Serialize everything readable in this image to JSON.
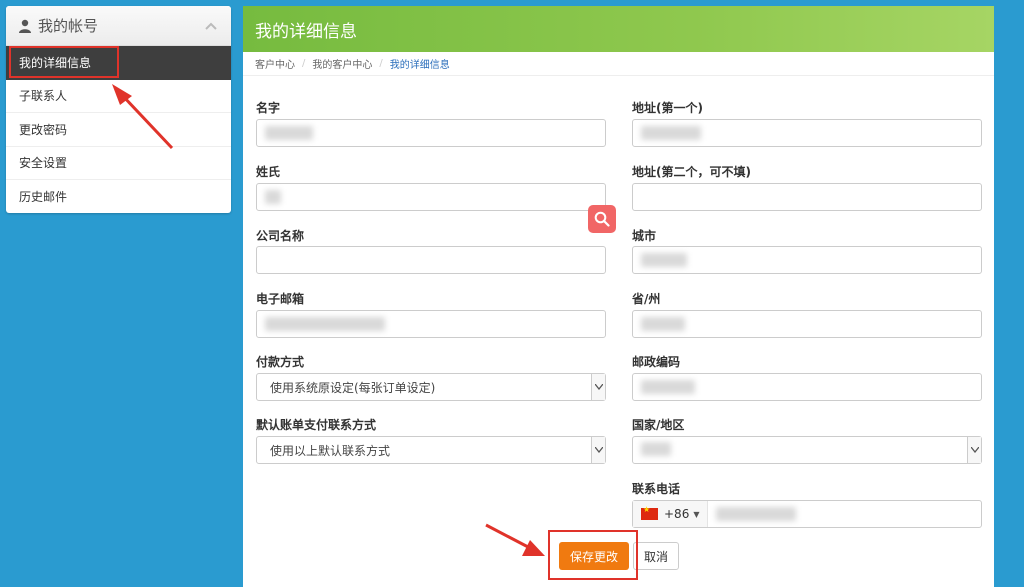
{
  "sidebar": {
    "title": "我的帐号",
    "items": [
      {
        "label": "我的详细信息"
      },
      {
        "label": "子联系人"
      },
      {
        "label": "更改密码"
      },
      {
        "label": "安全设置"
      },
      {
        "label": "历史邮件"
      }
    ]
  },
  "main": {
    "title": "我的详细信息",
    "breadcrumb": [
      "客户中心",
      "我的客户中心",
      "我的详细信息"
    ]
  },
  "form": {
    "first_name_label": "名字",
    "last_name_label": "姓氏",
    "company_label": "公司名称",
    "email_label": "电子邮箱",
    "payment_label": "付款方式",
    "payment_value": "使用系统原设定(每张订单设定)",
    "billing_contact_label": "默认账单支付联系方式",
    "billing_contact_value": "使用以上默认联系方式",
    "address1_label": "地址(第一个)",
    "address2_label": "地址(第二个，可不填)",
    "city_label": "城市",
    "state_label": "省/州",
    "postcode_label": "邮政编码",
    "country_label": "国家/地区",
    "phone_label": "联系电话",
    "phone_code": "+86"
  },
  "buttons": {
    "save": "保存更改",
    "cancel": "取消"
  },
  "colors": {
    "background": "#2a9bd0",
    "header_green": "#76bb3f",
    "save_orange": "#f07a10",
    "highlight_red": "#e0332a"
  },
  "icons": [
    "user-icon",
    "chevron-up-icon",
    "select-arrow-icon",
    "china-flag-icon",
    "search-icon"
  ]
}
